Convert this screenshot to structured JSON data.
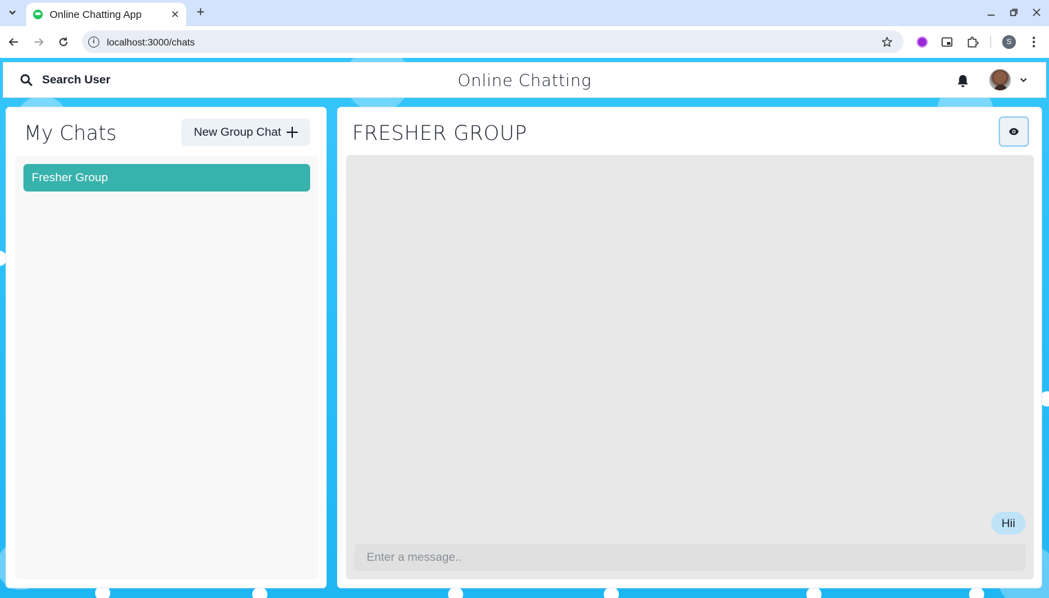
{
  "browser": {
    "tab_title": "Online Chatting App",
    "url": "localhost:3000/chats",
    "profile_initial": "S"
  },
  "header": {
    "search_label": "Search User",
    "app_title": "Online Chatting"
  },
  "sidebar": {
    "title": "My Chats",
    "new_group_label": "New Group Chat",
    "chats": [
      {
        "name": "Fresher Group",
        "selected": true
      }
    ]
  },
  "chat": {
    "title": "FRESHER GROUP",
    "messages": [
      {
        "text": "Hii",
        "mine": true
      }
    ],
    "input_placeholder": "Enter a message.."
  },
  "colors": {
    "selected_chat": "#38b2ac",
    "own_message": "#bee3f8",
    "page_background": "#33c3f8"
  }
}
